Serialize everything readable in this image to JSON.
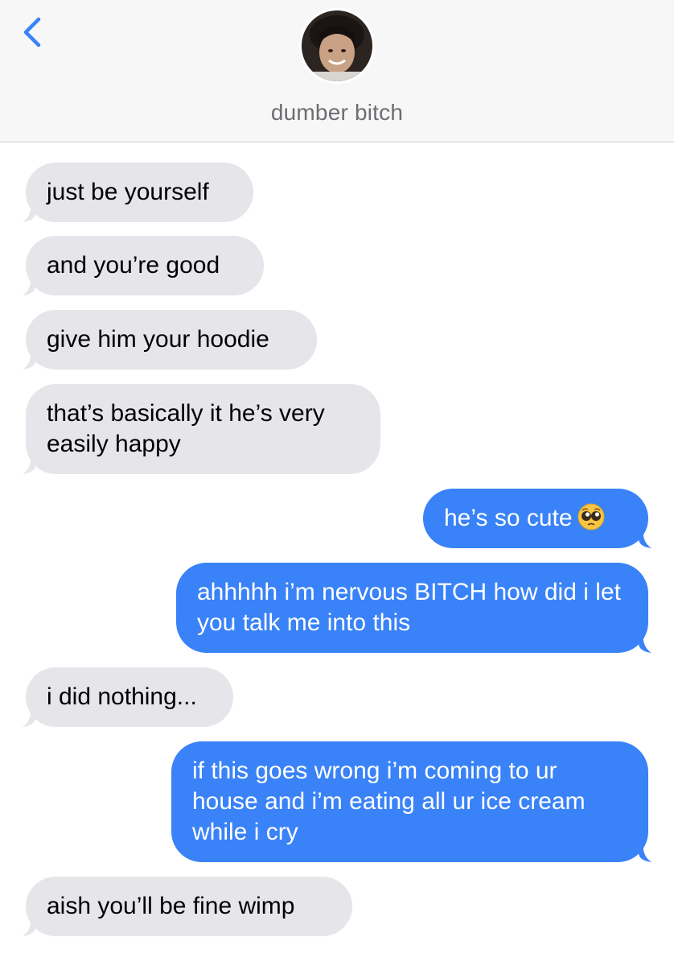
{
  "header": {
    "back_icon": "chevron-left-icon",
    "contact_name": "dumber bitch",
    "accent_color": "#3a82f7"
  },
  "messages": [
    {
      "direction": "incoming",
      "text": "just be yourself"
    },
    {
      "direction": "incoming",
      "text": "and you’re good"
    },
    {
      "direction": "incoming",
      "text": "give him your hoodie"
    },
    {
      "direction": "incoming",
      "text": "that’s basically it he’s very easily happy"
    },
    {
      "direction": "outgoing",
      "text": "he’s so cute",
      "emoji": "pleading-face-emoji"
    },
    {
      "direction": "outgoing",
      "text": "ahhhhh i’m nervous BITCH how did i let you talk me into this"
    },
    {
      "direction": "incoming",
      "text": "i did nothing..."
    },
    {
      "direction": "outgoing",
      "text": "if this goes wrong i’m coming to ur house and i’m eating all ur ice cream while i cry"
    },
    {
      "direction": "incoming",
      "text": "aish you’ll be fine wimp"
    }
  ],
  "colors": {
    "incoming_bubble": "#e5e5ea",
    "outgoing_bubble": "#3a82f7"
  }
}
